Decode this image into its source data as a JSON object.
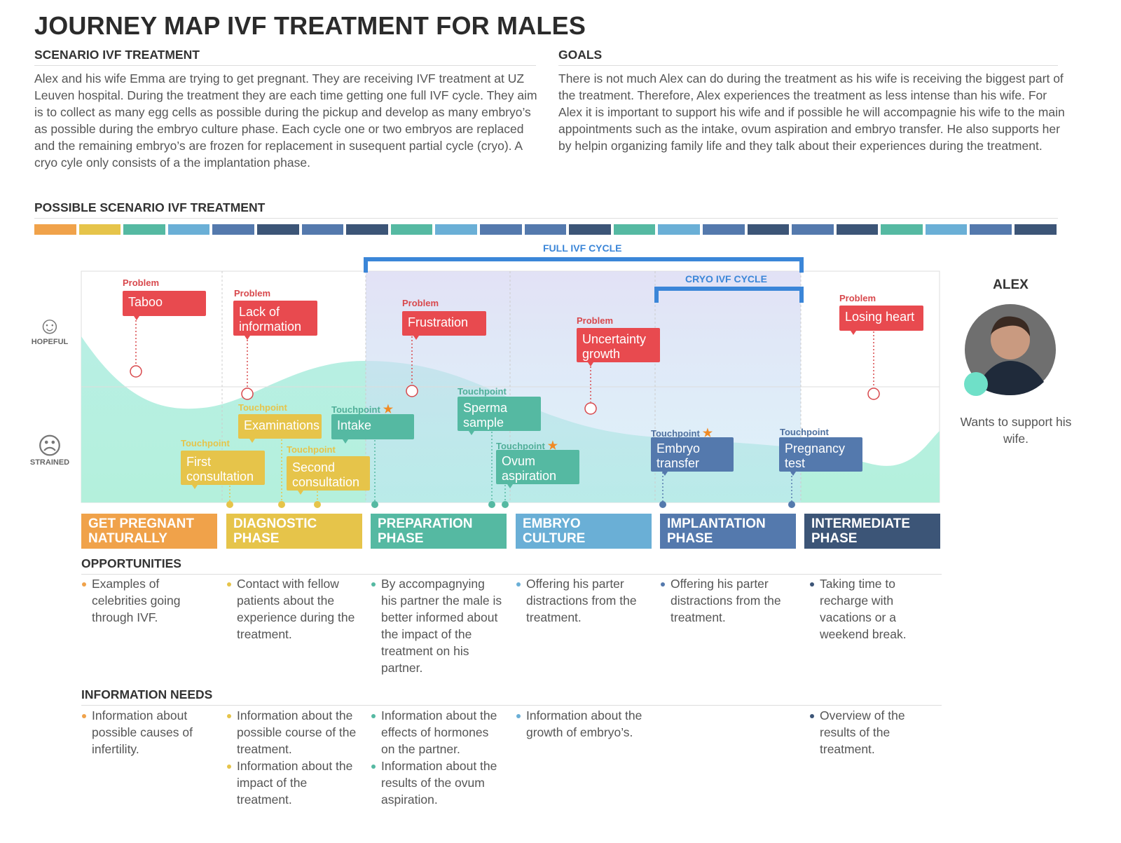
{
  "title": "JOURNEY MAP IVF TREATMENT FOR MALES",
  "scenario": {
    "heading": "SCENARIO IVF TREATMENT",
    "text": "Alex and his wife Emma are trying to get pregnant. They are receiving IVF treatment at UZ Leuven hospital. During the treatment they are each time getting one full IVF cycle. They aim is to collect as many egg cells as possible during the pickup and develop as many embryo’s as possible during the embryo culture phase. Each cycle one or two embryos are replaced and the remaining embryo’s are frozen for replacement in susequent partial cycle (cryo). A cryo cyle only consists of a the implantation phase."
  },
  "goals": {
    "heading": "GOALS",
    "text": "There is not much Alex can do during the treatment as his wife is receiving the biggest part of the treatment. Therefore, Alex experiences the treatment as less intense than his wife. For Alex it is important to support his wife and if possible he will accompagnie his wife to the main appointments such as the intake, ovum aspiration and embryo transfer. He also supports her by helpin organizing family life and they talk about their experiences during the treatment."
  },
  "possible_heading": "POSSIBLE SCENARIO IVF TREATMENT",
  "colors": {
    "orange": "#f0a24a",
    "yellow": "#e6c44a",
    "teal": "#55b9a2",
    "lightblue": "#6aafd6",
    "blue": "#5479ad",
    "navy": "#3c5577",
    "problem": "#e84a4f",
    "cycle": "#3b86d8",
    "curve": "#b4f0e2"
  },
  "colorbar": [
    "orange",
    "yellow",
    "teal",
    "lightblue",
    "blue",
    "navy",
    "blue",
    "navy",
    "teal",
    "lightblue",
    "blue",
    "blue",
    "navy",
    "teal",
    "lightblue",
    "blue",
    "navy",
    "blue",
    "navy",
    "teal",
    "lightblue",
    "blue",
    "navy"
  ],
  "cycles": {
    "full": "FULL IVF CYCLE",
    "cryo": "CRYO IVF CYCLE"
  },
  "emotions": {
    "hopeful": "HOPEFUL",
    "strained": "STRAINED",
    "hopeful_icon": "smiley-face-icon",
    "strained_icon": "sad-face-icon"
  },
  "problem_label": "Problem",
  "touchpoint_label": "Touchpoint",
  "problems": [
    "Taboo",
    "Lack of information",
    "Frustration",
    "Uncertainty growth",
    "Losing heart"
  ],
  "touchpoints": [
    {
      "text": "First consultation",
      "starred": false
    },
    {
      "text": "Examinations",
      "starred": false
    },
    {
      "text": "Second consultation",
      "starred": false
    },
    {
      "text": "Intake",
      "starred": true
    },
    {
      "text": "Sperma sample",
      "starred": false
    },
    {
      "text": "Ovum aspiration",
      "starred": true
    },
    {
      "text": "Embryo transfer",
      "starred": true
    },
    {
      "text": "Pregnancy test",
      "starred": false
    }
  ],
  "persona": {
    "name": "ALEX",
    "quote": "Wants to support his wife."
  },
  "phases": [
    "GET PREGNANT NATURALLY",
    "DIAGNOSTIC PHASE",
    "PREPARATION PHASE",
    "EMBRYO CULTURE",
    "IMPLANTATION PHASE",
    "INTERMEDIATE PHASE"
  ],
  "opportunities": {
    "heading": "OPPORTUNITIES",
    "cols": [
      [
        "Examples of celebrities going through IVF."
      ],
      [
        "Contact with fellow patients about the experience during the treatment."
      ],
      [
        "By accompagnying his partner the male is better informed about the impact of the treatment on his partner."
      ],
      [
        "Offering his parter distractions from the treatment."
      ],
      [
        "Offering his parter distractions from the treatment."
      ],
      [
        "Taking time to recharge with vacations or a weekend break."
      ]
    ]
  },
  "info_needs": {
    "heading": "INFORMATION NEEDS",
    "cols": [
      [
        "Information about possible causes of infertility."
      ],
      [
        "Information about the possible course of the treatment.",
        "Information about the impact of the treatment."
      ],
      [
        "Information about the effects of hormones on the partner.",
        "Information about the results of the ovum aspiration."
      ],
      [
        "Information about the growth of embryo’s."
      ],
      [],
      [
        "Overview of the results of the treatment."
      ]
    ]
  }
}
